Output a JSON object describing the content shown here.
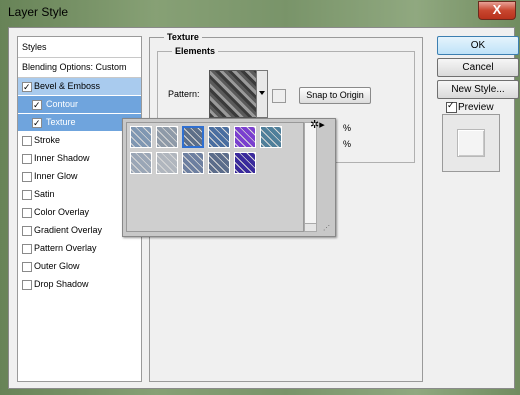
{
  "window": {
    "title": "Layer Style",
    "close_glyph": "X"
  },
  "style_list": {
    "header": "Styles",
    "blending": "Blending Options: Custom",
    "items": [
      {
        "label": "Bevel & Emboss",
        "checked": true
      },
      {
        "label": "Contour",
        "checked": true
      },
      {
        "label": "Texture",
        "checked": true
      },
      {
        "label": "Stroke",
        "checked": false
      },
      {
        "label": "Inner Shadow",
        "checked": false
      },
      {
        "label": "Inner Glow",
        "checked": false
      },
      {
        "label": "Satin",
        "checked": false
      },
      {
        "label": "Color Overlay",
        "checked": false
      },
      {
        "label": "Gradient Overlay",
        "checked": false
      },
      {
        "label": "Pattern Overlay",
        "checked": false
      },
      {
        "label": "Outer Glow",
        "checked": false
      },
      {
        "label": "Drop Shadow",
        "checked": false
      }
    ]
  },
  "texture": {
    "group_title": "Texture",
    "elements_title": "Elements",
    "pattern_label": "Pattern:",
    "snap_button": "Snap to Origin",
    "pct1": "%",
    "pct2": "%"
  },
  "picker": {
    "gear_icon": "gear-icon",
    "swatches": [
      {
        "color": "#7f97b2"
      },
      {
        "color": "#8e9aa8"
      },
      {
        "color": "#5d6f88"
      },
      {
        "color": "#4a6ea0"
      },
      {
        "color": "#7a3fcf"
      },
      {
        "color": "#4f7f9a"
      },
      {
        "color": "#9aa6b6"
      },
      {
        "color": "#b0b6be"
      },
      {
        "color": "#6d7fa0"
      },
      {
        "color": "#5b6c8a"
      },
      {
        "color": "#3a2a9c"
      }
    ],
    "selected_index": 2
  },
  "buttons": {
    "ok": "OK",
    "cancel": "Cancel",
    "new_style": "New Style..."
  },
  "preview": {
    "label": "Preview",
    "checked": true
  }
}
